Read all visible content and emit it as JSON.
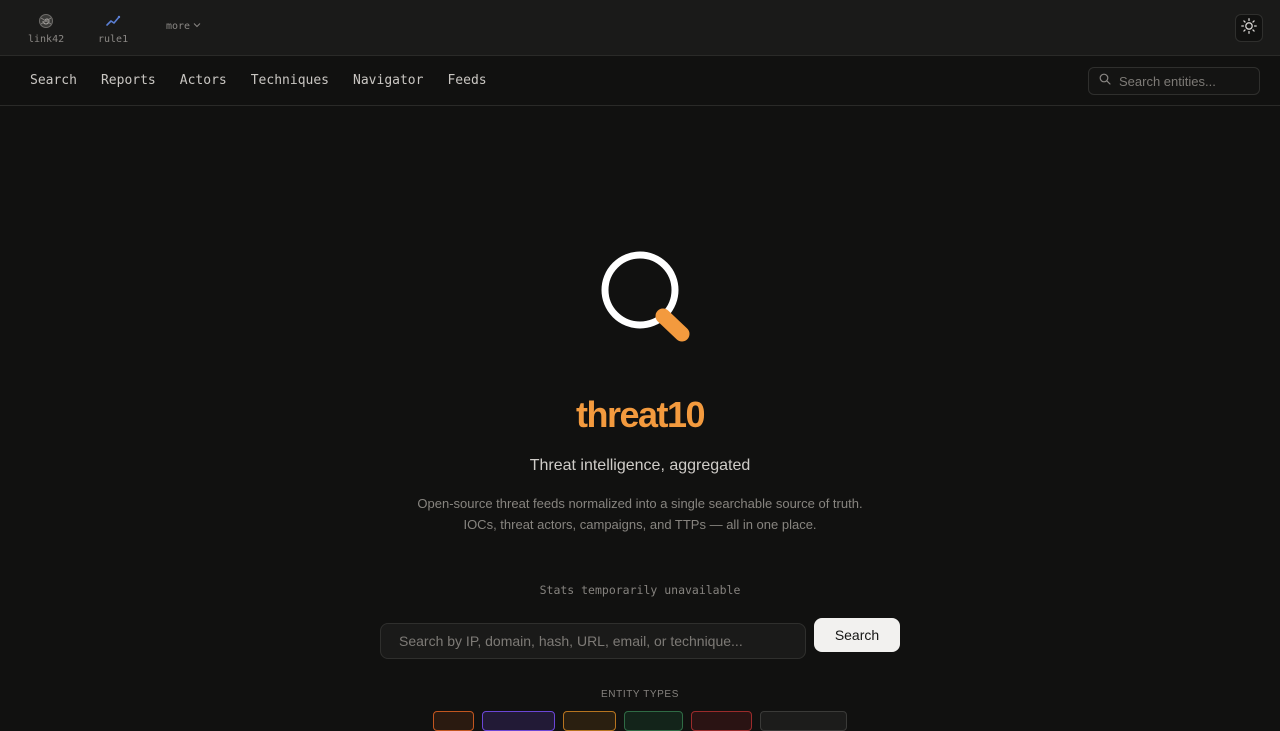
{
  "topbar": {
    "apps": [
      {
        "label": "link42",
        "icon": "spiral-icon"
      },
      {
        "label": "rule1",
        "icon": "trend-line-icon"
      }
    ],
    "more_label": "more",
    "theme_toggle_icon": "sun-icon"
  },
  "nav": {
    "links": [
      "Search",
      "Reports",
      "Actors",
      "Techniques",
      "Navigator",
      "Feeds"
    ],
    "search_placeholder": "Search entities..."
  },
  "hero": {
    "brand": "threat10",
    "tagline": "Threat intelligence, aggregated",
    "description_line1": "Open-source threat feeds normalized into a single searchable source of truth.",
    "description_line2": "IOCs, threat actors, campaigns, and TTPs — all in one place.",
    "stats_status": "Stats temporarily unavailable"
  },
  "search": {
    "placeholder": "Search by IP, domain, hash, URL, email, or technique...",
    "button_label": "Search"
  },
  "entity_types": {
    "heading": "ENTITY TYPES"
  },
  "colors": {
    "accent": "#f39a3e",
    "chip_orange": "#c2561f",
    "chip_purple": "#6b46d6",
    "chip_amber": "#b7741f",
    "chip_green": "#2f6b45",
    "chip_red": "#9b2b2b",
    "chip_gray": "#3a3a38"
  }
}
